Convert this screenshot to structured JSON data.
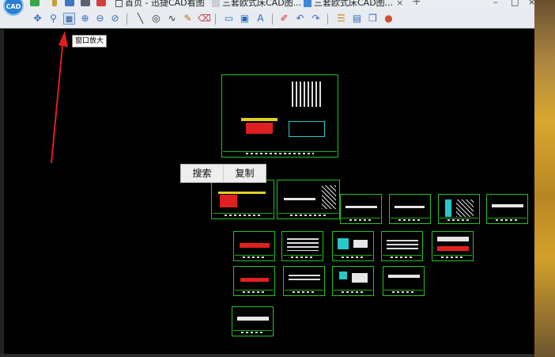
{
  "app": {
    "logo_text": "CAD",
    "tabs": [
      {
        "label": "首页 - 迅捷CAD看图",
        "close": ""
      },
      {
        "label": "三套欧式床CAD图...",
        "close": "×"
      },
      {
        "label": "三套欧式床CAD图...",
        "close": "×"
      }
    ],
    "new_tab": "+",
    "window": {
      "minimize": "–",
      "maximize": "□",
      "close": "×"
    }
  },
  "toolbar": {
    "tooltip": "窗口放大",
    "icons": [
      "pan-icon",
      "zoom-realtime-icon",
      "window-zoom-icon",
      "zoom-in-icon",
      "zoom-out-icon",
      "zoom-previous-icon",
      "line-icon",
      "circle-icon",
      "polyline-icon",
      "sketch-icon",
      "eraser-icon",
      "rectangle-icon",
      "image-icon",
      "text-icon",
      "pen-icon",
      "undo-icon",
      "redo-icon",
      "layers-icon",
      "save-icon",
      "3d-icon",
      "color-icon"
    ]
  },
  "context_menu": {
    "search": "搜索",
    "copy": "复制"
  },
  "colors": {
    "sheet_border": "#25c025",
    "canvas_bg": "#000000",
    "annotation_arrow": "#e02020"
  }
}
